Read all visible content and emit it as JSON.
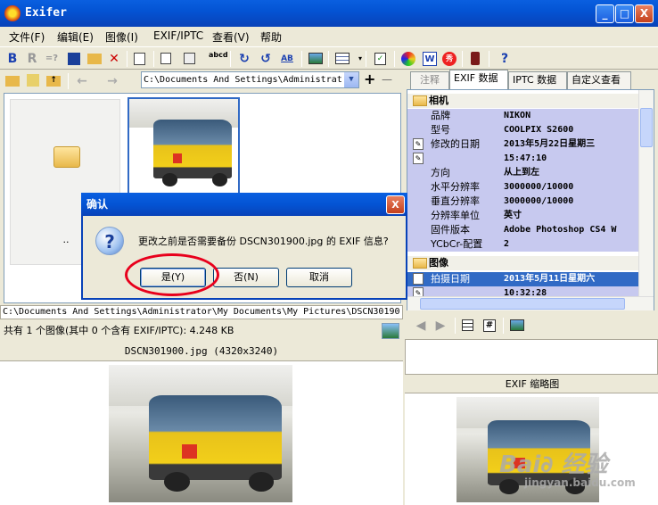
{
  "window": {
    "title": "Exifer",
    "min": "_",
    "max": "□",
    "close": "X"
  },
  "menu": [
    "文件(F)",
    "编辑(E)",
    "图像(I)",
    "EXIF/IPTC",
    "查看(V)",
    "帮助"
  ],
  "toolbar1": {
    "bold_b": "B",
    "bold_r": "R",
    "eq": "=?",
    "undo": "↺",
    "redo": "↻",
    "ab": "AB",
    "abcd": "abcd",
    "help": "?"
  },
  "path_combo": {
    "value": "C:\\Documents And Settings\\Administrat",
    "arrow": "▼"
  },
  "nav": {
    "plus": "+",
    "minus": "—",
    "back": "←",
    "fwd": "→"
  },
  "folder_label": "..",
  "path_status": "C:\\Documents And Settings\\Administrator\\My Documents\\My Pictures\\DSCN30190",
  "count_status": "共有 1 个图像(其中 0 个含有 EXIF/IPTC): 4.248 KB",
  "preview_caption": "DSCN301900.jpg (4320x3240)",
  "tabs": [
    "注释",
    "EXIF 数据",
    "IPTC 数据",
    "自定义查看"
  ],
  "exif": {
    "group_camera": "相机",
    "rows": [
      {
        "k": "品牌",
        "v": "NIKON"
      },
      {
        "k": "型号",
        "v": "COOLPIX S2600"
      },
      {
        "k": "修改的日期",
        "v": "2013年5月22日星期三"
      },
      {
        "k": "",
        "v": "15:47:10"
      },
      {
        "k": "方向",
        "v": "从上到左"
      },
      {
        "k": "水平分辨率",
        "v": "3000000/10000"
      },
      {
        "k": "垂直分辨率",
        "v": "3000000/10000"
      },
      {
        "k": "分辨率单位",
        "v": "英寸"
      },
      {
        "k": "固件版本",
        "v": "Adobe Photoshop CS4 W"
      },
      {
        "k": "YCbCr-配置",
        "v": "2"
      }
    ],
    "group_image": "图像",
    "rows2": [
      {
        "k": "拍摄日期",
        "v": "2013年5月11日星期六"
      },
      {
        "k": "",
        "v": "10:32:28"
      }
    ]
  },
  "thumb_caption": "EXIF 缩略图",
  "dialog": {
    "title": "确认",
    "close": "X",
    "icon": "?",
    "message": "更改之前是否需要备份 DSCN301900.jpg 的 EXIF 信息?",
    "yes": "是(Y)",
    "no": "否(N)",
    "cancel": "取消"
  },
  "watermark": {
    "big": "Bai∂ 经验",
    "small": "jingyan.baidu.com"
  }
}
